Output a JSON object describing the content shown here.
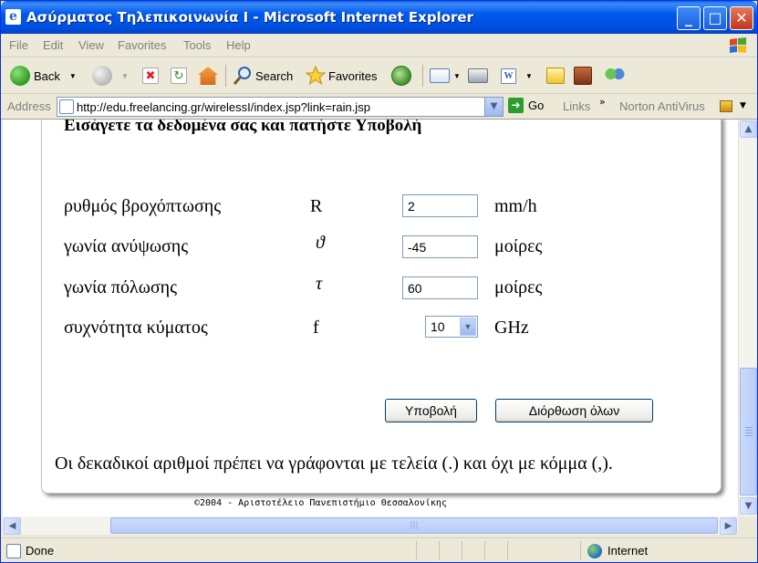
{
  "window": {
    "title": "Ασύρματος Τηλεπικοινωνία Ι - Microsoft Internet Explorer",
    "minimize": "_",
    "maximize": "□",
    "close": "✕"
  },
  "menu": {
    "items": [
      "File",
      "Edit",
      "View",
      "Favorites",
      "Tools",
      "Help"
    ]
  },
  "toolbar": {
    "back_label": "Back",
    "search_label": "Search",
    "favorites_label": "Favorites"
  },
  "address": {
    "label": "Address",
    "url": "http://edu.freelancing.gr/wirelessI/index.jsp?link=rain.jsp",
    "go_label": "Go",
    "links_label": "Links",
    "norton_label": "Norton AntiVirus"
  },
  "form": {
    "heading": "Εισάγετε τα δεδομένα σας και πατήστε Υποβολή",
    "rows": [
      {
        "label": "ρυθμός βροχόπτωσης",
        "symbol": "R",
        "value": "2",
        "unit": "mm/h"
      },
      {
        "label": "γωνία ανύψωσης",
        "symbol": "ϑ",
        "value": "-45",
        "unit": "μοίρες"
      },
      {
        "label": "γωνία πόλωσης",
        "symbol": "τ",
        "value": "60",
        "unit": "μοίρες"
      },
      {
        "label": "συχνότητα κύματος",
        "symbol": "f",
        "value": "10",
        "unit": "GHz"
      }
    ],
    "submit_label": "Υποβολή",
    "reset_label": "Διόρθωση όλων",
    "note": "Οι δεκαδικοί αριθμοί πρέπει να γράφονται με τελεία (.) και όχι με κόμμα (,).",
    "footer": "©2004 - Αριστοτέλειο Πανεπιστήμιο Θεσσαλονίκης"
  },
  "status": {
    "text": "Done",
    "zone": "Internet"
  }
}
